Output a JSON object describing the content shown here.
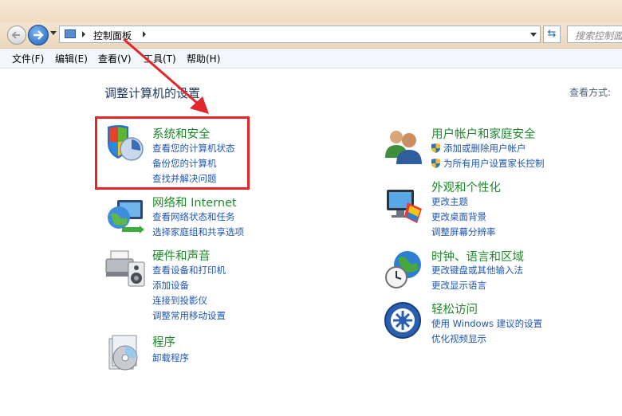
{
  "address": {
    "breadcrumb": "控制面板",
    "search_placeholder": "搜索控制面"
  },
  "menu": [
    {
      "label": "文件(F)"
    },
    {
      "label": "编辑(E)"
    },
    {
      "label": "查看(V)"
    },
    {
      "label": "工具(T)"
    },
    {
      "label": "帮助(H)"
    }
  ],
  "page": {
    "heading": "调整计算机的设置",
    "view_by": "查看方式:"
  },
  "categories": [
    {
      "title": "系统和安全",
      "icon": "shield-security-icon",
      "links": [
        "查看您的计算机状态",
        "备份您的计算机",
        "查找并解决问题"
      ]
    },
    {
      "title": "网络和 Internet",
      "icon": "network-globe-icon",
      "links": [
        "查看网络状态和任务",
        "选择家庭组和共享选项"
      ]
    },
    {
      "title": "硬件和声音",
      "icon": "printer-hardware-icon",
      "links": [
        "查看设备和打印机",
        "添加设备",
        "连接到投影仪",
        "调整常用移动设置"
      ]
    },
    {
      "title": "程序",
      "icon": "programs-disc-icon",
      "links": [
        "卸载程序"
      ]
    },
    {
      "title": "用户帐户和家庭安全",
      "icon": "users-icon",
      "links": [
        "添加或删除用户帐户",
        "为所有用户设置家长控制"
      ]
    },
    {
      "title": "外观和个性化",
      "icon": "monitor-palette-icon",
      "links": [
        "更改主题",
        "更改桌面背景",
        "调整屏幕分辨率"
      ]
    },
    {
      "title": "时钟、语言和区域",
      "icon": "clock-globe-icon",
      "links": [
        "更改键盘或其他输入法",
        "更改显示语言"
      ]
    },
    {
      "title": "轻松访问",
      "icon": "ease-of-access-icon",
      "links": [
        "使用 Windows 建议的设置",
        "优化视频显示"
      ]
    }
  ],
  "colors": {
    "annotation": "#e3262b",
    "category_title": "#1e8a2a",
    "link": "#1e56b4"
  }
}
